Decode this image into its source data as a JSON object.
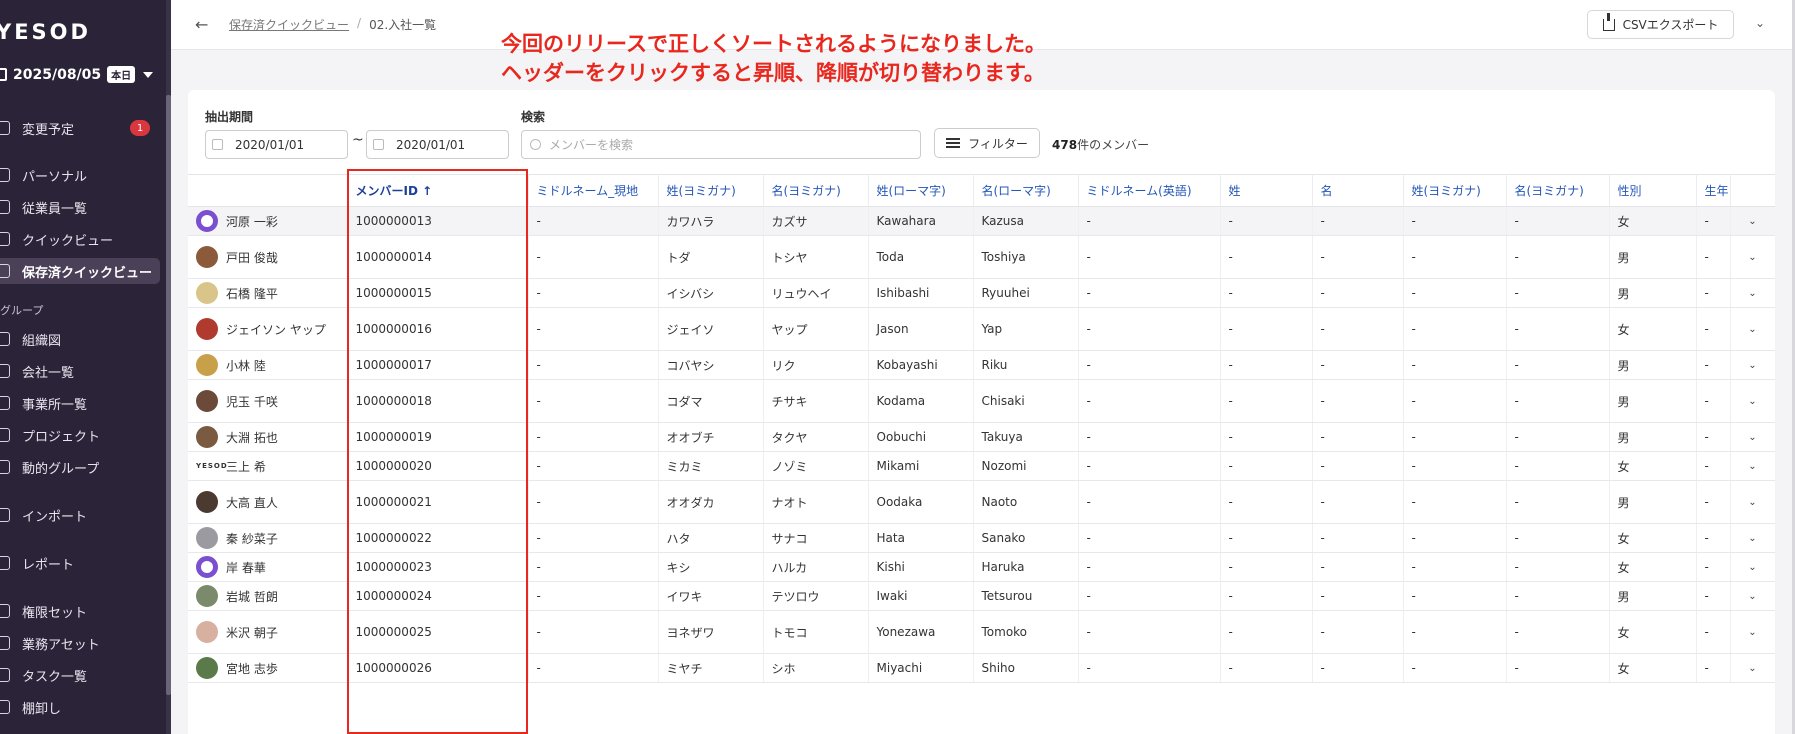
{
  "sidebar": {
    "logo": "YESOD",
    "date": "2025/08/05",
    "today_badge": "本日",
    "items": [
      {
        "label": "変更予定",
        "badge": "1"
      },
      {
        "label": "パーソナル"
      },
      {
        "label": "従業員一覧"
      },
      {
        "label": "クイックビュー"
      },
      {
        "label": "保存済クイックビュー"
      },
      {
        "label": "組織図"
      },
      {
        "label": "会社一覧"
      },
      {
        "label": "事業所一覧"
      },
      {
        "label": "プロジェクト"
      },
      {
        "label": "動的グループ"
      },
      {
        "label": "インポート"
      },
      {
        "label": "レポート"
      },
      {
        "label": "権限セット"
      },
      {
        "label": "業務アセット"
      },
      {
        "label": "タスク一覧"
      },
      {
        "label": "棚卸し"
      }
    ],
    "group_label": "グループ"
  },
  "topbar": {
    "breadcrumb_link": "保存済クイックビュー",
    "breadcrumb_sep": "/",
    "breadcrumb_current": "02.入社一覧",
    "csv_label": "CSVエクスポート"
  },
  "annotation": {
    "line1": "今回のリリースで正しくソートされるようになりました。",
    "line2": "ヘッダーをクリックすると昇順、降順が切り替わります。"
  },
  "filters": {
    "period_label": "抽出期間",
    "date_from": "2020/01/01",
    "tilde": "~",
    "date_to": "2020/01/01",
    "search_label": "検索",
    "search_placeholder": "メンバーを検索",
    "filter_label": "フィルター",
    "count_number": "478",
    "count_suffix": "件のメンバー"
  },
  "table": {
    "headers": [
      "",
      "メンバーID ↑",
      "ミドルネーム_現地",
      "姓(ヨミガナ)",
      "名(ヨミガナ)",
      "姓(ローマ字)",
      "名(ローマ字)",
      "ミドルネーム(英語)",
      "姓",
      "名",
      "姓(ヨミガナ)",
      "名(ヨミガナ)",
      "性別",
      "生年",
      ""
    ],
    "rows": [
      [
        "河原 一彩",
        "1000000013",
        "-",
        "カワハラ",
        "カズサ",
        "Kawahara",
        "Kazusa",
        "-",
        "-",
        "-",
        "-",
        "-",
        "女",
        "-"
      ],
      [
        "戸田 俊哉",
        "1000000014",
        "-",
        "トダ",
        "トシヤ",
        "Toda",
        "Toshiya",
        "-",
        "-",
        "-",
        "-",
        "-",
        "男",
        "-"
      ],
      [
        "石橋 隆平",
        "1000000015",
        "-",
        "イシバシ",
        "リュウヘイ",
        "Ishibashi",
        "Ryuuhei",
        "-",
        "-",
        "-",
        "-",
        "-",
        "男",
        "-"
      ],
      [
        "ジェイソン ヤップ",
        "1000000016",
        "-",
        "ジェイソ",
        "ヤップ",
        "Jason",
        "Yap",
        "-",
        "-",
        "-",
        "-",
        "-",
        "女",
        "-"
      ],
      [
        "小林 陸",
        "1000000017",
        "-",
        "コバヤシ",
        "リク",
        "Kobayashi",
        "Riku",
        "-",
        "-",
        "-",
        "-",
        "-",
        "男",
        "-"
      ],
      [
        "児玉 千咲",
        "1000000018",
        "-",
        "コダマ",
        "チサキ",
        "Kodama",
        "Chisaki",
        "-",
        "-",
        "-",
        "-",
        "-",
        "男",
        "-"
      ],
      [
        "大淵 拓也",
        "1000000019",
        "-",
        "オオブチ",
        "タクヤ",
        "Oobuchi",
        "Takuya",
        "-",
        "-",
        "-",
        "-",
        "-",
        "男",
        "-"
      ],
      [
        "三上 希",
        "1000000020",
        "-",
        "ミカミ",
        "ノゾミ",
        "Mikami",
        "Nozomi",
        "-",
        "-",
        "-",
        "-",
        "-",
        "女",
        "-"
      ],
      [
        "大高 直人",
        "1000000021",
        "-",
        "オオダカ",
        "ナオト",
        "Oodaka",
        "Naoto",
        "-",
        "-",
        "-",
        "-",
        "-",
        "男",
        "-"
      ],
      [
        "秦 紗菜子",
        "1000000022",
        "-",
        "ハタ",
        "サナコ",
        "Hata",
        "Sanako",
        "-",
        "-",
        "-",
        "-",
        "-",
        "女",
        "-"
      ],
      [
        "岸 春華",
        "1000000023",
        "-",
        "キシ",
        "ハルカ",
        "Kishi",
        "Haruka",
        "-",
        "-",
        "-",
        "-",
        "-",
        "女",
        "-"
      ],
      [
        "岩城 哲朗",
        "1000000024",
        "-",
        "イワキ",
        "テツロウ",
        "Iwaki",
        "Tetsurou",
        "-",
        "-",
        "-",
        "-",
        "-",
        "男",
        "-"
      ],
      [
        "米沢 朝子",
        "1000000025",
        "-",
        "ヨネザワ",
        "トモコ",
        "Yonezawa",
        "Tomoko",
        "-",
        "-",
        "-",
        "-",
        "-",
        "女",
        "-"
      ],
      [
        "宮地 志歩",
        "1000000026",
        "-",
        "ミヤチ",
        "シホ",
        "Miyachi",
        "Shiho",
        "-",
        "-",
        "-",
        "-",
        "-",
        "女",
        "-"
      ]
    ],
    "avatar_logo_text": "YESOD"
  }
}
